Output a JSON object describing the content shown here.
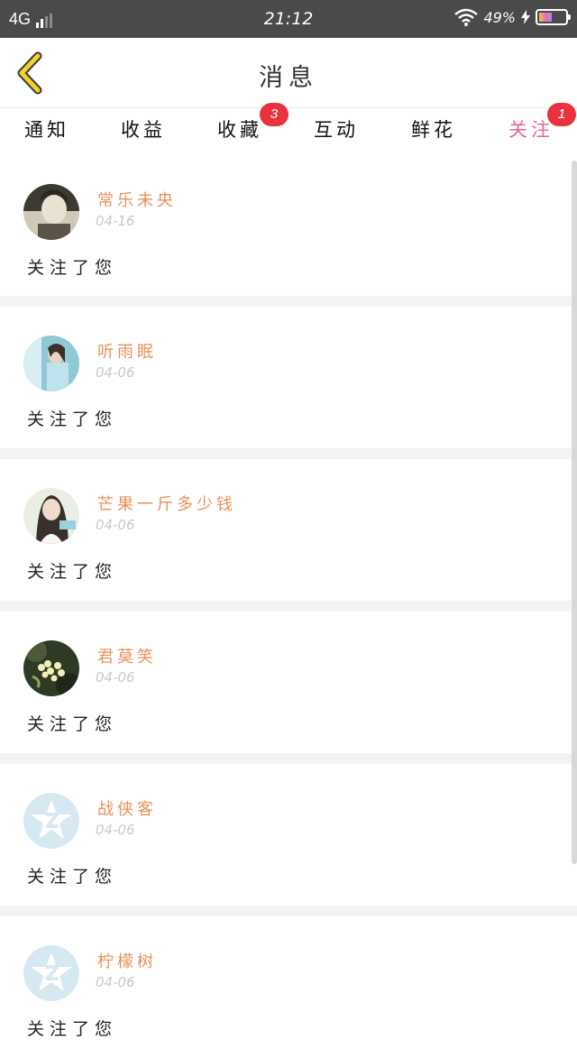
{
  "status_bar": {
    "network": "4G",
    "time": "21:12",
    "battery_percent": "49%",
    "battery_level": 0.49
  },
  "header": {
    "title": "消息",
    "back_icon": "chevron-left-icon",
    "back_color": "#f2d12a"
  },
  "tabs": [
    {
      "label": "通知",
      "badge": null,
      "active": false
    },
    {
      "label": "收益",
      "badge": null,
      "active": false
    },
    {
      "label": "收藏",
      "badge": "3",
      "active": false
    },
    {
      "label": "互动",
      "badge": null,
      "active": false
    },
    {
      "label": "鲜花",
      "badge": null,
      "active": false
    },
    {
      "label": "关注",
      "badge": "1",
      "active": true
    }
  ],
  "accent_color": "#e8679a",
  "name_color": "#e8915a",
  "notifications": [
    {
      "nickname": "常乐未央",
      "date": "04-16",
      "message": "关注了您",
      "avatar": "photo-avatar-dark"
    },
    {
      "nickname": "听雨眠",
      "date": "04-06",
      "message": "关注了您",
      "avatar": "photo-avatar-blue"
    },
    {
      "nickname": "芒果一斤多少钱",
      "date": "04-06",
      "message": "关注了您",
      "avatar": "photo-avatar-girl"
    },
    {
      "nickname": "君莫笑",
      "date": "04-06",
      "message": "关注了您",
      "avatar": "photo-avatar-flowers"
    },
    {
      "nickname": "战侠客",
      "date": "04-06",
      "message": "关注了您",
      "avatar": "default-star-avatar"
    },
    {
      "nickname": "柠檬树",
      "date": "04-06",
      "message": "关注了您",
      "avatar": "default-star-avatar"
    }
  ]
}
